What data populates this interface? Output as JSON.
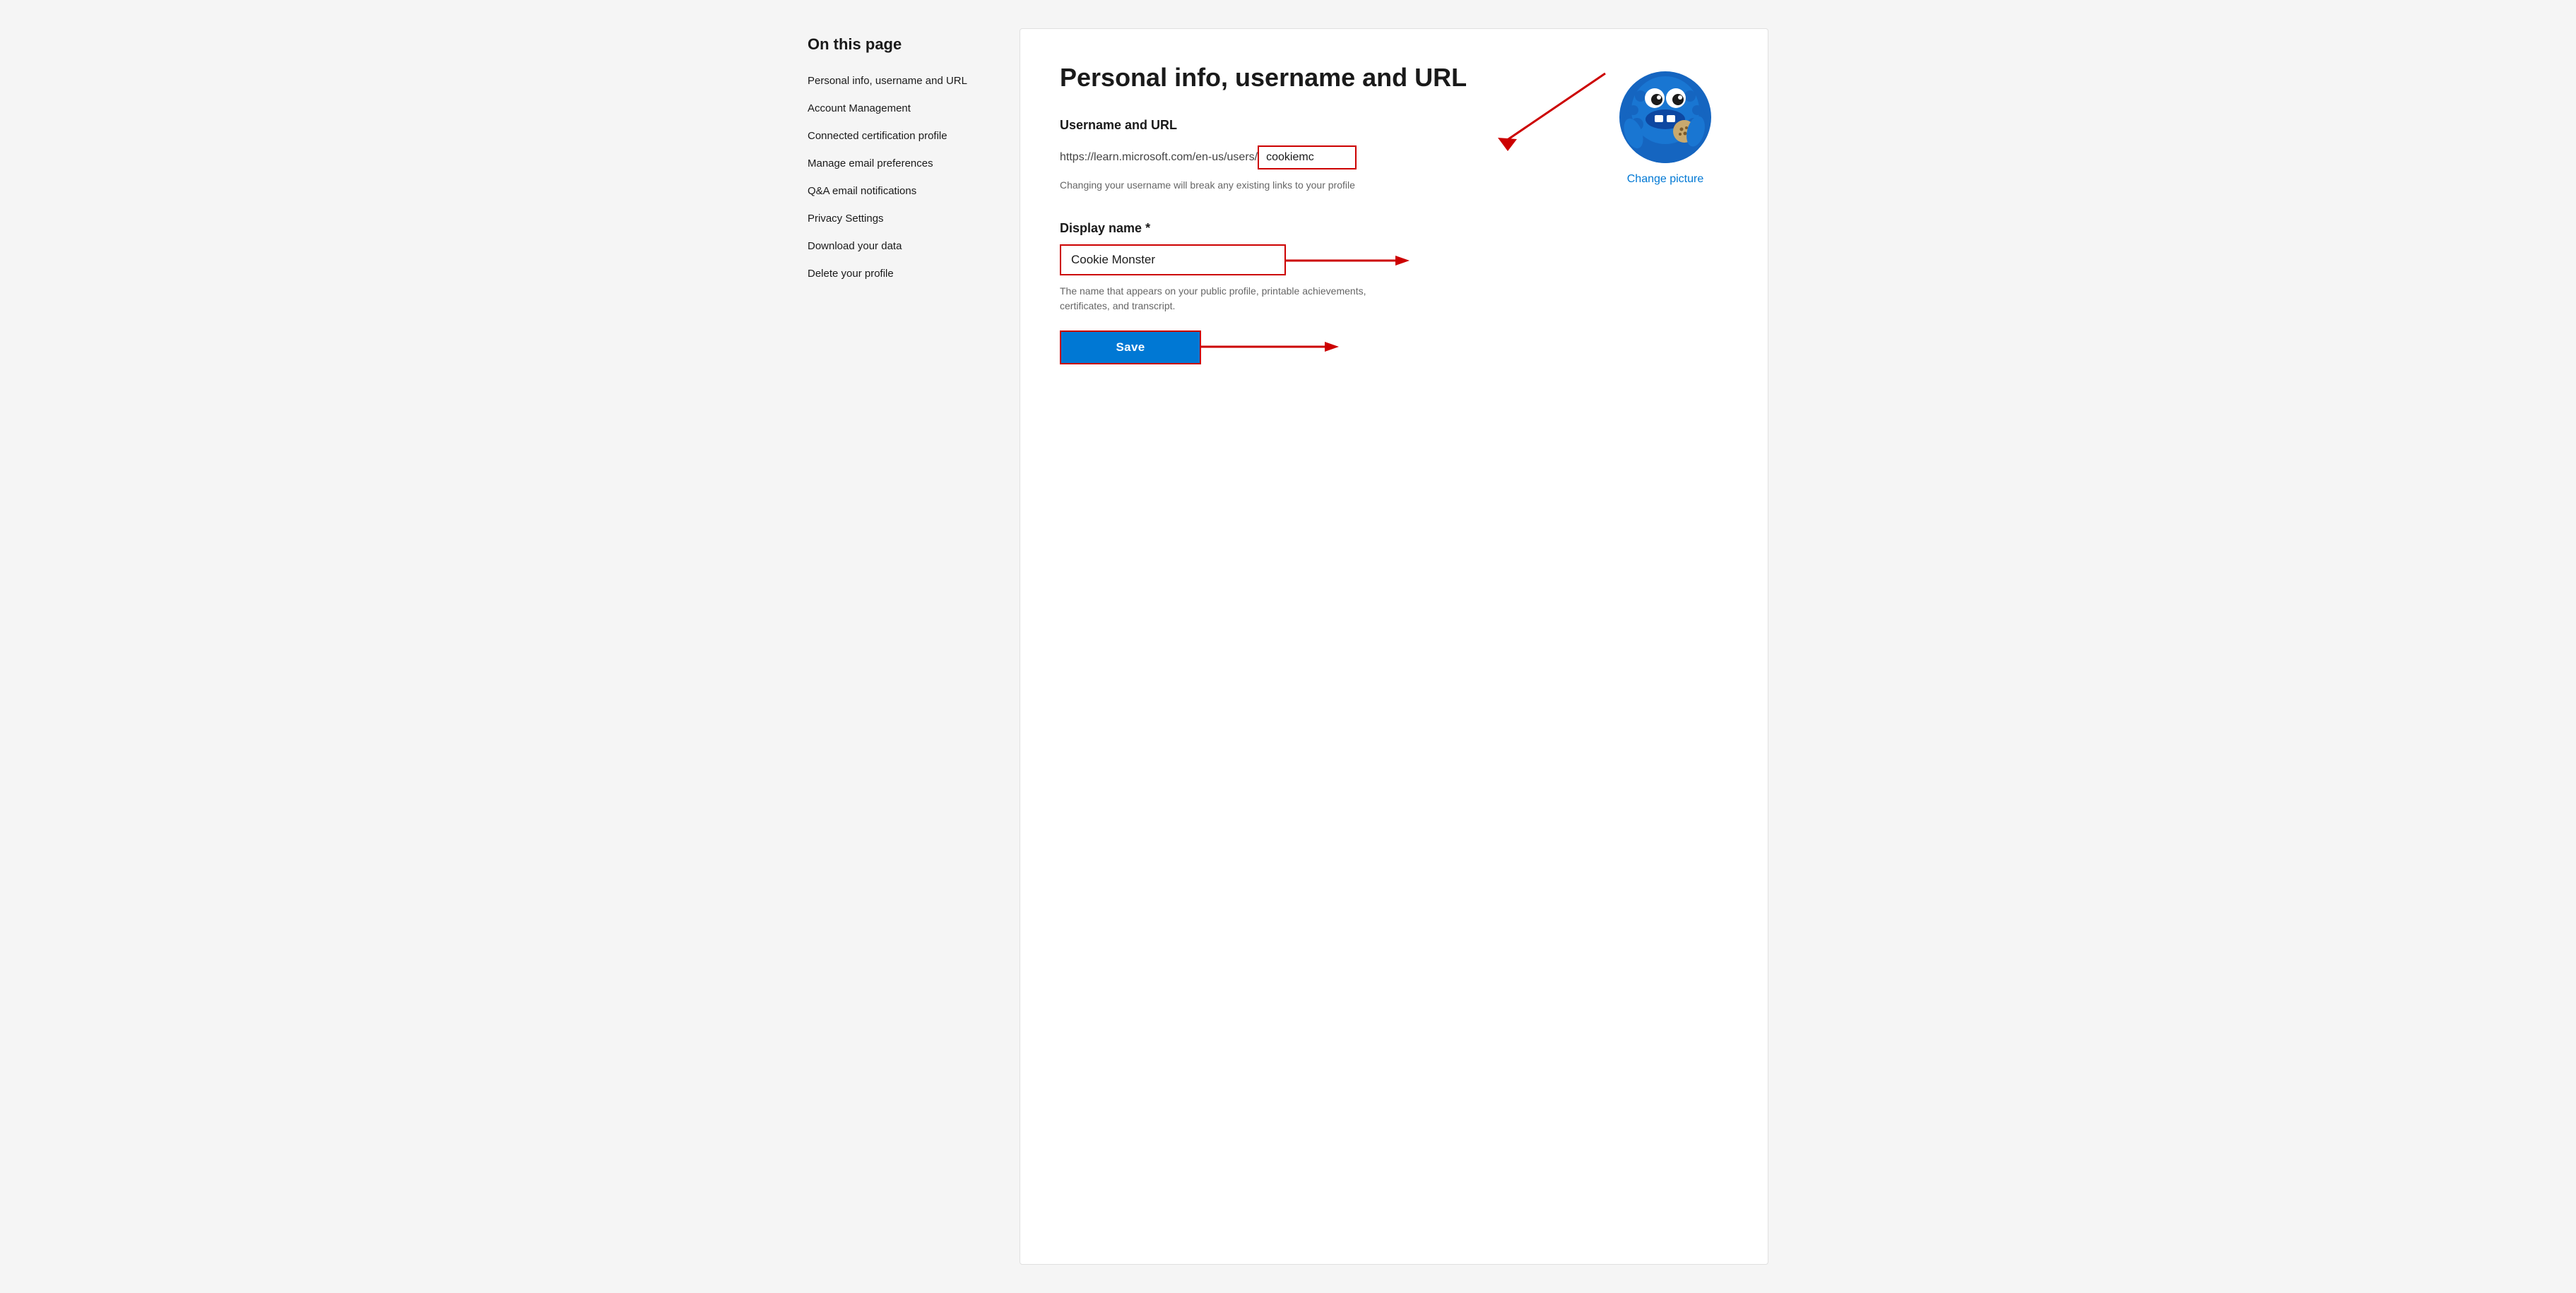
{
  "sidebar": {
    "title": "On this page",
    "nav_items": [
      {
        "label": "Personal info, username and URL",
        "id": "personal-info"
      },
      {
        "label": "Account Management",
        "id": "account-management"
      },
      {
        "label": "Connected certification profile",
        "id": "connected-cert"
      },
      {
        "label": "Manage email preferences",
        "id": "email-prefs"
      },
      {
        "label": "Q&A email notifications",
        "id": "qa-notifications"
      },
      {
        "label": "Privacy Settings",
        "id": "privacy-settings"
      },
      {
        "label": "Download your data",
        "id": "download-data"
      },
      {
        "label": "Delete your profile",
        "id": "delete-profile"
      }
    ]
  },
  "main": {
    "heading": "Personal info, username and URL",
    "username_section": {
      "title": "Username and URL",
      "url_prefix": "https://learn.microsoft.com/en-us/users/",
      "username_value": "cookiemc",
      "warning_text": "Changing your username will break any existing links to your profile"
    },
    "display_name_section": {
      "label": "Display name",
      "required": "*",
      "value": "Cookie Monster",
      "hint": "The name that appears on your public profile, printable achievements, certificates, and transcript."
    },
    "save_button_label": "Save",
    "change_picture_label": "Change picture"
  }
}
